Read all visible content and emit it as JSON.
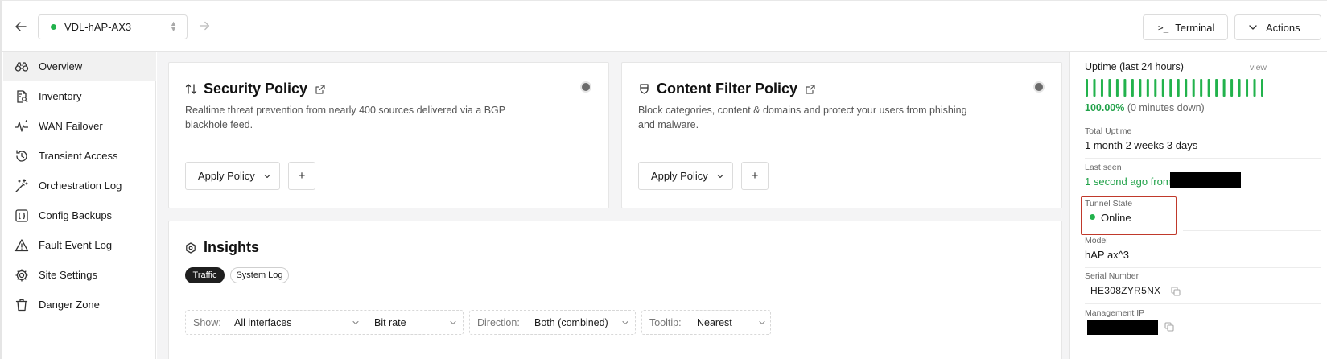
{
  "header": {
    "device_name": "VDL-hAP-AX3",
    "device_status_color": "#22b24c",
    "terminal_glyph": ">_",
    "terminal_label": "Terminal",
    "actions_label": "Actions"
  },
  "sidebar": {
    "items": [
      {
        "label": "Overview",
        "icon": "binoculars-icon",
        "active": true
      },
      {
        "label": "Inventory",
        "icon": "document-search-icon",
        "active": false
      },
      {
        "label": "WAN Failover",
        "icon": "activity-icon",
        "active": false
      },
      {
        "label": "Transient Access",
        "icon": "clock-history-icon",
        "active": false
      },
      {
        "label": "Orchestration Log",
        "icon": "magic-wand-icon",
        "active": false
      },
      {
        "label": "Config Backups",
        "icon": "braces-file-icon",
        "active": false
      },
      {
        "label": "Fault Event Log",
        "icon": "warning-triangle-icon",
        "active": false
      },
      {
        "label": "Site Settings",
        "icon": "gear-icon",
        "active": false
      },
      {
        "label": "Danger Zone",
        "icon": "trash-icon",
        "active": false
      }
    ]
  },
  "security_policy": {
    "title": "Security Policy",
    "description": "Realtime threat prevention from nearly 400 sources delivered via a BGP blackhole feed.",
    "apply_label": "Apply Policy",
    "add_label": "+"
  },
  "content_filter": {
    "title": "Content Filter Policy",
    "description": "Block categories, content & domains and protect your users from phishing and malware.",
    "apply_label": "Apply Policy",
    "add_label": "+"
  },
  "insights": {
    "title": "Insights",
    "tabs": [
      {
        "label": "Traffic",
        "active": true
      },
      {
        "label": "System Log",
        "active": false
      }
    ],
    "filters": {
      "show_label": "Show:",
      "interfaces_value": "All interfaces",
      "metric_value": "Bit rate",
      "direction_label": "Direction:",
      "direction_value": "Both (combined)",
      "tooltip_label": "Tooltip:",
      "tooltip_value": "Nearest"
    }
  },
  "details": {
    "uptime_title": "Uptime (last 24 hours)",
    "uptime_view": "view",
    "uptime_percent": 100.0,
    "uptime_percent_text": "100.00%",
    "uptime_down_text": "(0 minutes down)",
    "uptime_bar_count": 24,
    "uptime_bar_color": "#22b24c",
    "total_uptime_label": "Total Uptime",
    "total_uptime_value": "1 month 2 weeks 3 days",
    "last_seen_label": "Last seen",
    "last_seen_value": "1 second ago from",
    "tunnel_state_label": "Tunnel State",
    "tunnel_state_value": "Online",
    "model_label": "Model",
    "model_value": "hAP ax^3",
    "serial_label": "Serial Number",
    "serial_value": "HE308ZYR5NX",
    "mgmt_ip_label": "Management IP"
  },
  "colors": {
    "online_green": "#22b24c",
    "highlight_red": "#c0392b",
    "active_pill": "#1f1f1f"
  }
}
